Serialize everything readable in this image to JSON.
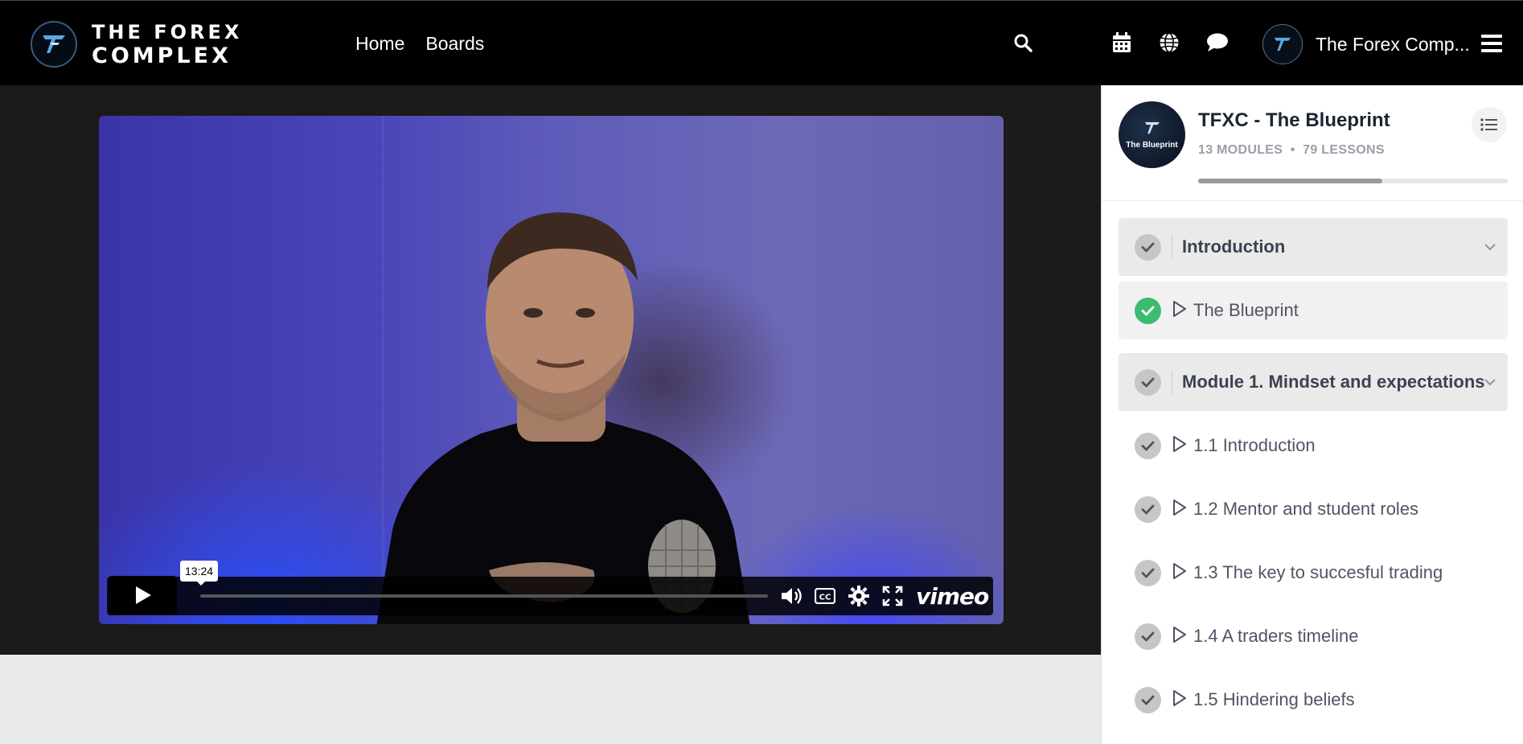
{
  "header": {
    "logo_line1": "THE FOREX",
    "logo_line2": "COMPLEX",
    "nav": [
      {
        "label": "Home"
      },
      {
        "label": "Boards"
      }
    ],
    "profile_name": "The Forex Comp..."
  },
  "video": {
    "hover_time": "13:24",
    "progress_fraction": 0.0,
    "brand": "vimeo"
  },
  "course": {
    "title": "TFXC - The Blueprint",
    "thumb_label": "The Blueprint",
    "modules_count": "13 MODULES",
    "lessons_count": "79 LESSONS",
    "progress_fraction": 0.595
  },
  "outline": [
    {
      "type": "module",
      "title": "Introduction",
      "completed": false
    },
    {
      "type": "lesson",
      "title": "The Blueprint",
      "completed": true,
      "active": true
    },
    {
      "type": "module",
      "title": "Module 1. Mindset and expectations",
      "completed": false
    },
    {
      "type": "lesson",
      "title": "1.1 Introduction",
      "completed": false
    },
    {
      "type": "lesson",
      "title": "1.2 Mentor and student roles",
      "completed": false
    },
    {
      "type": "lesson",
      "title": "1.3 The key to succesful trading",
      "completed": false
    },
    {
      "type": "lesson",
      "title": "1.4 A traders timeline",
      "completed": false
    },
    {
      "type": "lesson",
      "title": "1.5 Hindering beliefs",
      "completed": false
    }
  ],
  "colors": {
    "topbar": "#000000",
    "completed_check": "#3dbb71",
    "pending_check": "#c6c6c6",
    "video_accent": "#4a45b8"
  }
}
